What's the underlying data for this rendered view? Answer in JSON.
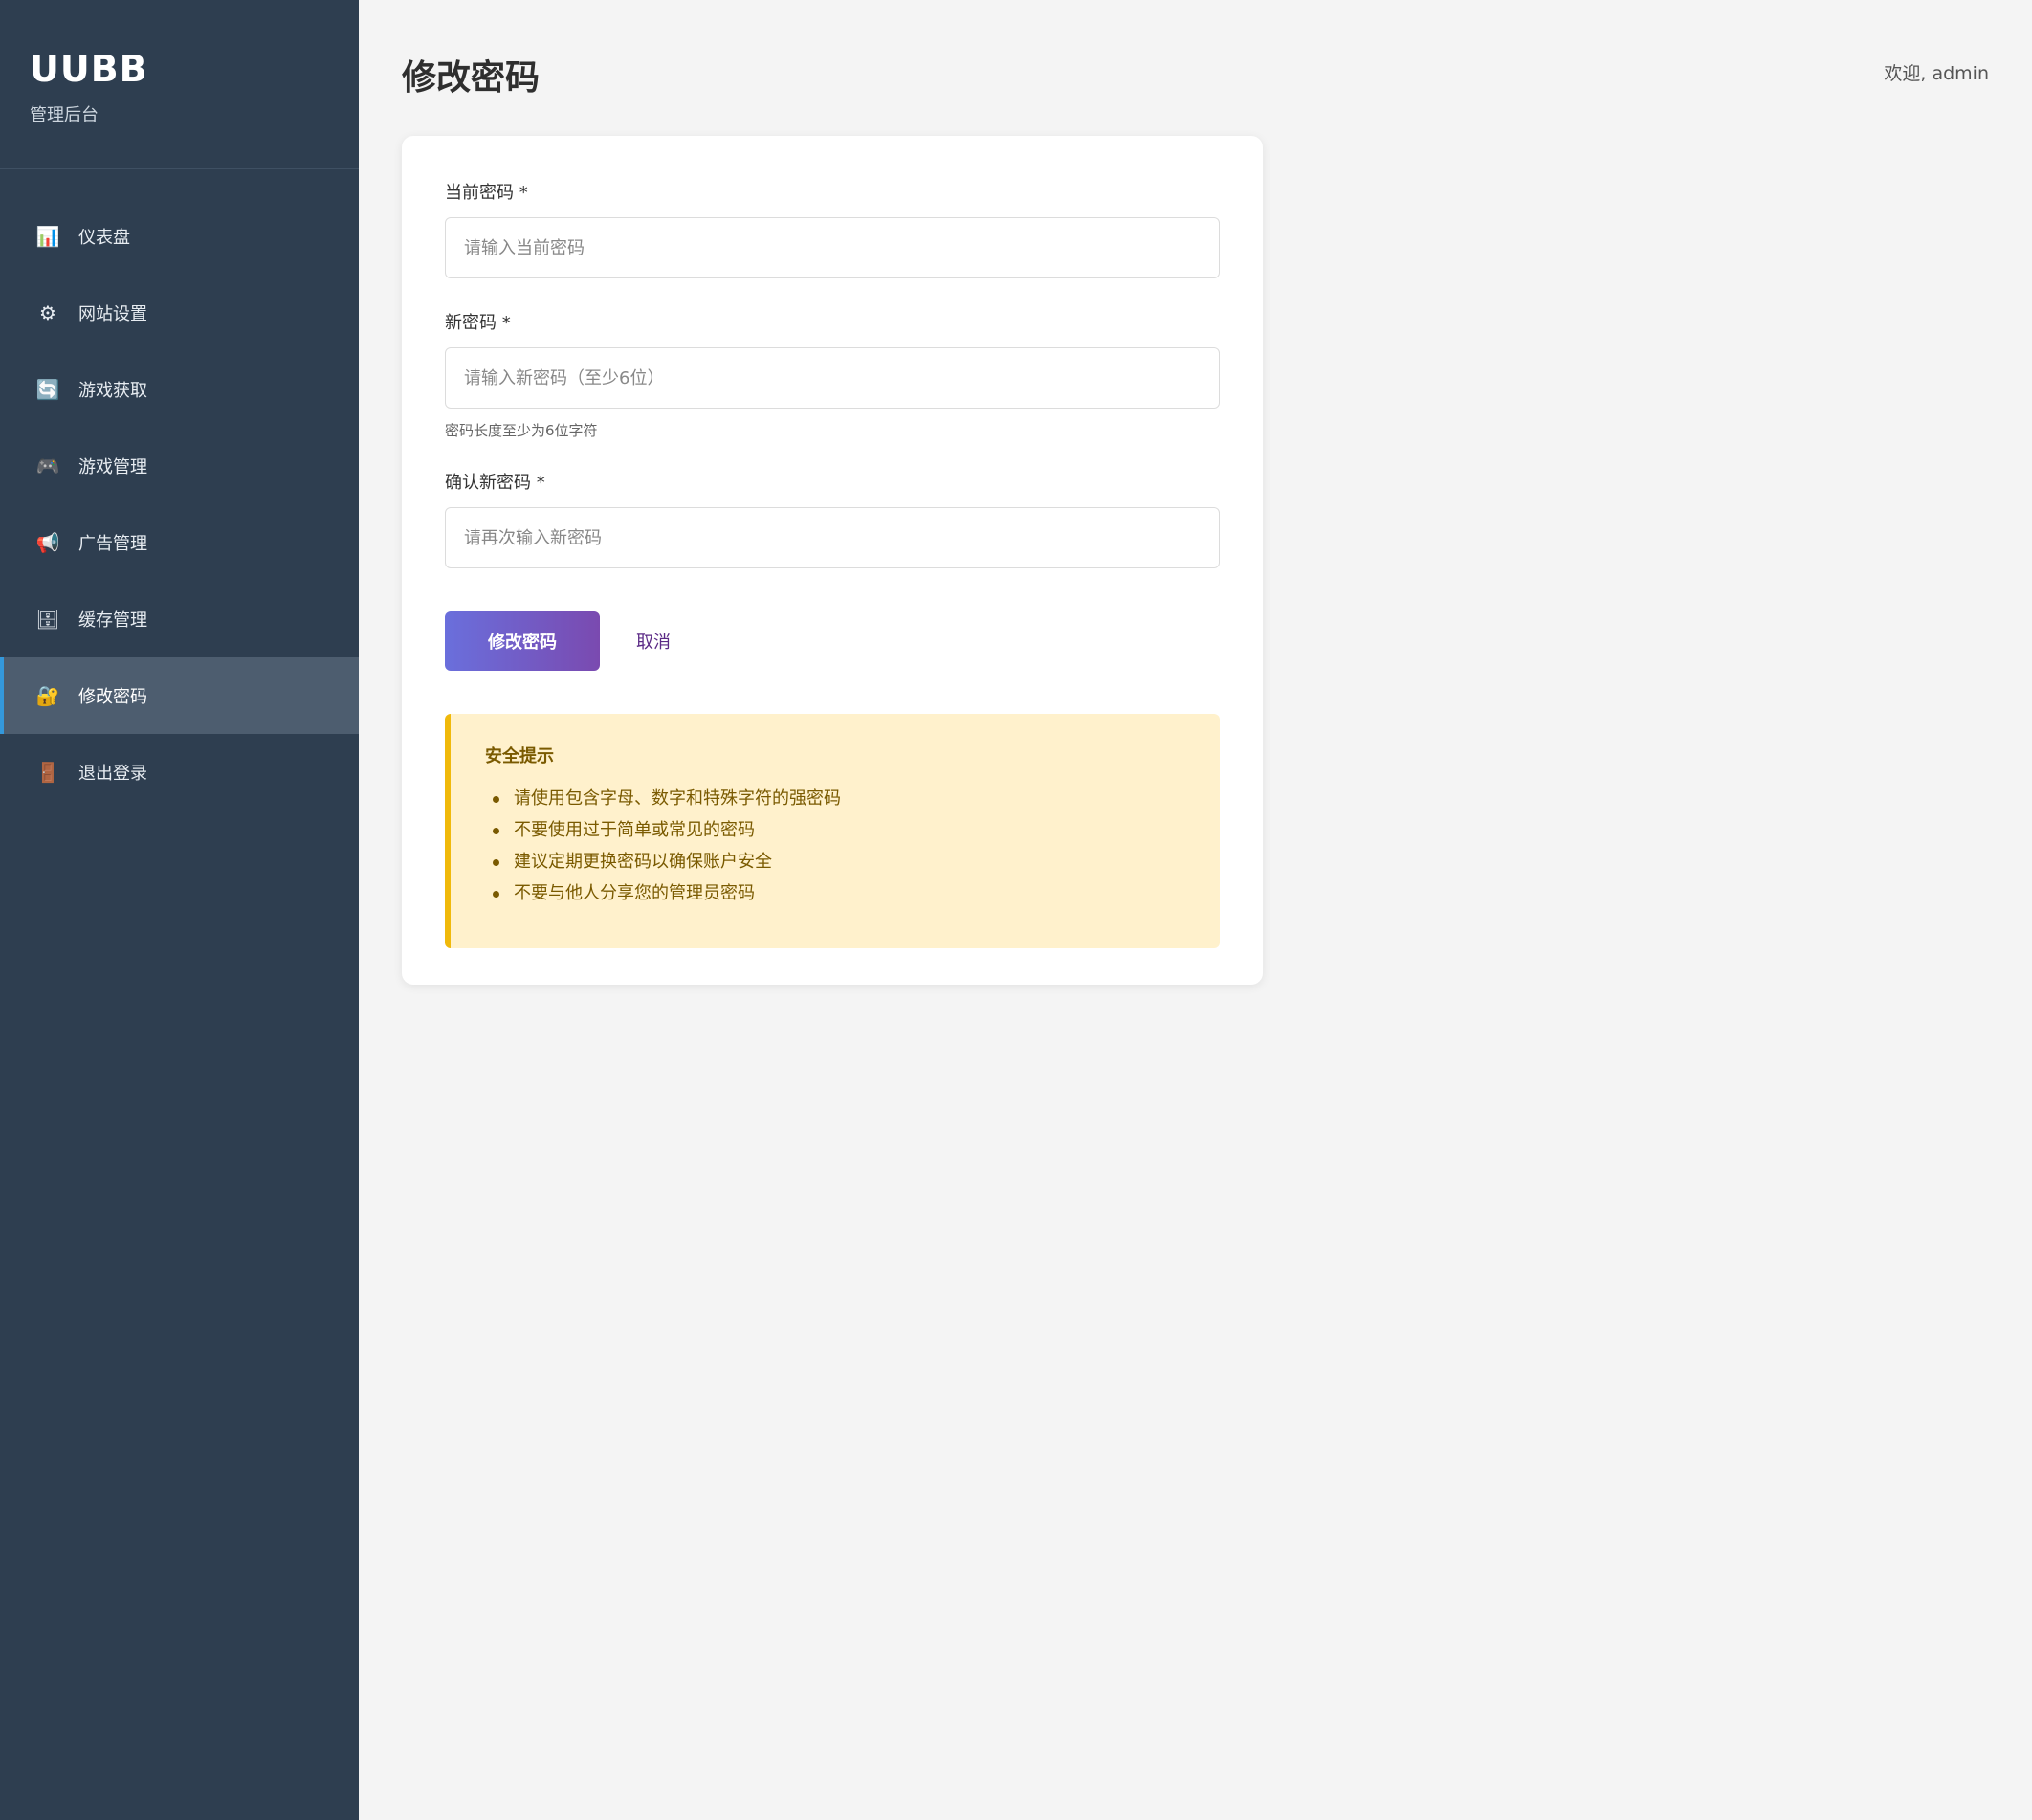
{
  "brand": {
    "title": "UUBB",
    "subtitle": "管理后台"
  },
  "nav": [
    {
      "label": "仪表盘",
      "icon": "📊",
      "icon_name": "chart-icon"
    },
    {
      "label": "网站设置",
      "icon": "⚙",
      "icon_name": "gear-icon"
    },
    {
      "label": "游戏获取",
      "icon": "🔄",
      "icon_name": "refresh-icon"
    },
    {
      "label": "游戏管理",
      "icon": "🎮",
      "icon_name": "gamepad-icon"
    },
    {
      "label": "广告管理",
      "icon": "📢",
      "icon_name": "megaphone-icon"
    },
    {
      "label": "缓存管理",
      "icon": "🗄",
      "icon_name": "cabinet-icon"
    },
    {
      "label": "修改密码",
      "icon": "🔐",
      "icon_name": "lock-icon",
      "active": true
    },
    {
      "label": "退出登录",
      "icon": "🚪",
      "icon_name": "door-icon"
    }
  ],
  "header": {
    "title": "修改密码",
    "welcome": "欢迎, admin"
  },
  "form": {
    "current_password": {
      "label": "当前密码 *",
      "placeholder": "请输入当前密码",
      "value": ""
    },
    "new_password": {
      "label": "新密码 *",
      "placeholder": "请输入新密码（至少6位）",
      "value": "",
      "hint": "密码长度至少为6位字符"
    },
    "confirm_password": {
      "label": "确认新密码 *",
      "placeholder": "请再次输入新密码",
      "value": ""
    },
    "submit_label": "修改密码",
    "cancel_label": "取消"
  },
  "tips": {
    "title": "安全提示",
    "items": [
      "请使用包含字母、数字和特殊字符的强密码",
      "不要使用过于简单或常见的密码",
      "建议定期更换密码以确保账户安全",
      "不要与他人分享您的管理员密码"
    ]
  },
  "colors": {
    "sidebar_bg": "#2e3e50",
    "active_item_bg": "#4d5d6f",
    "active_accent": "#3498db",
    "button_gradient": [
      "#6a6fdc",
      "#7a4ab0"
    ],
    "tips_bg": "#fff1cc",
    "tips_accent": "#f0b90b"
  }
}
